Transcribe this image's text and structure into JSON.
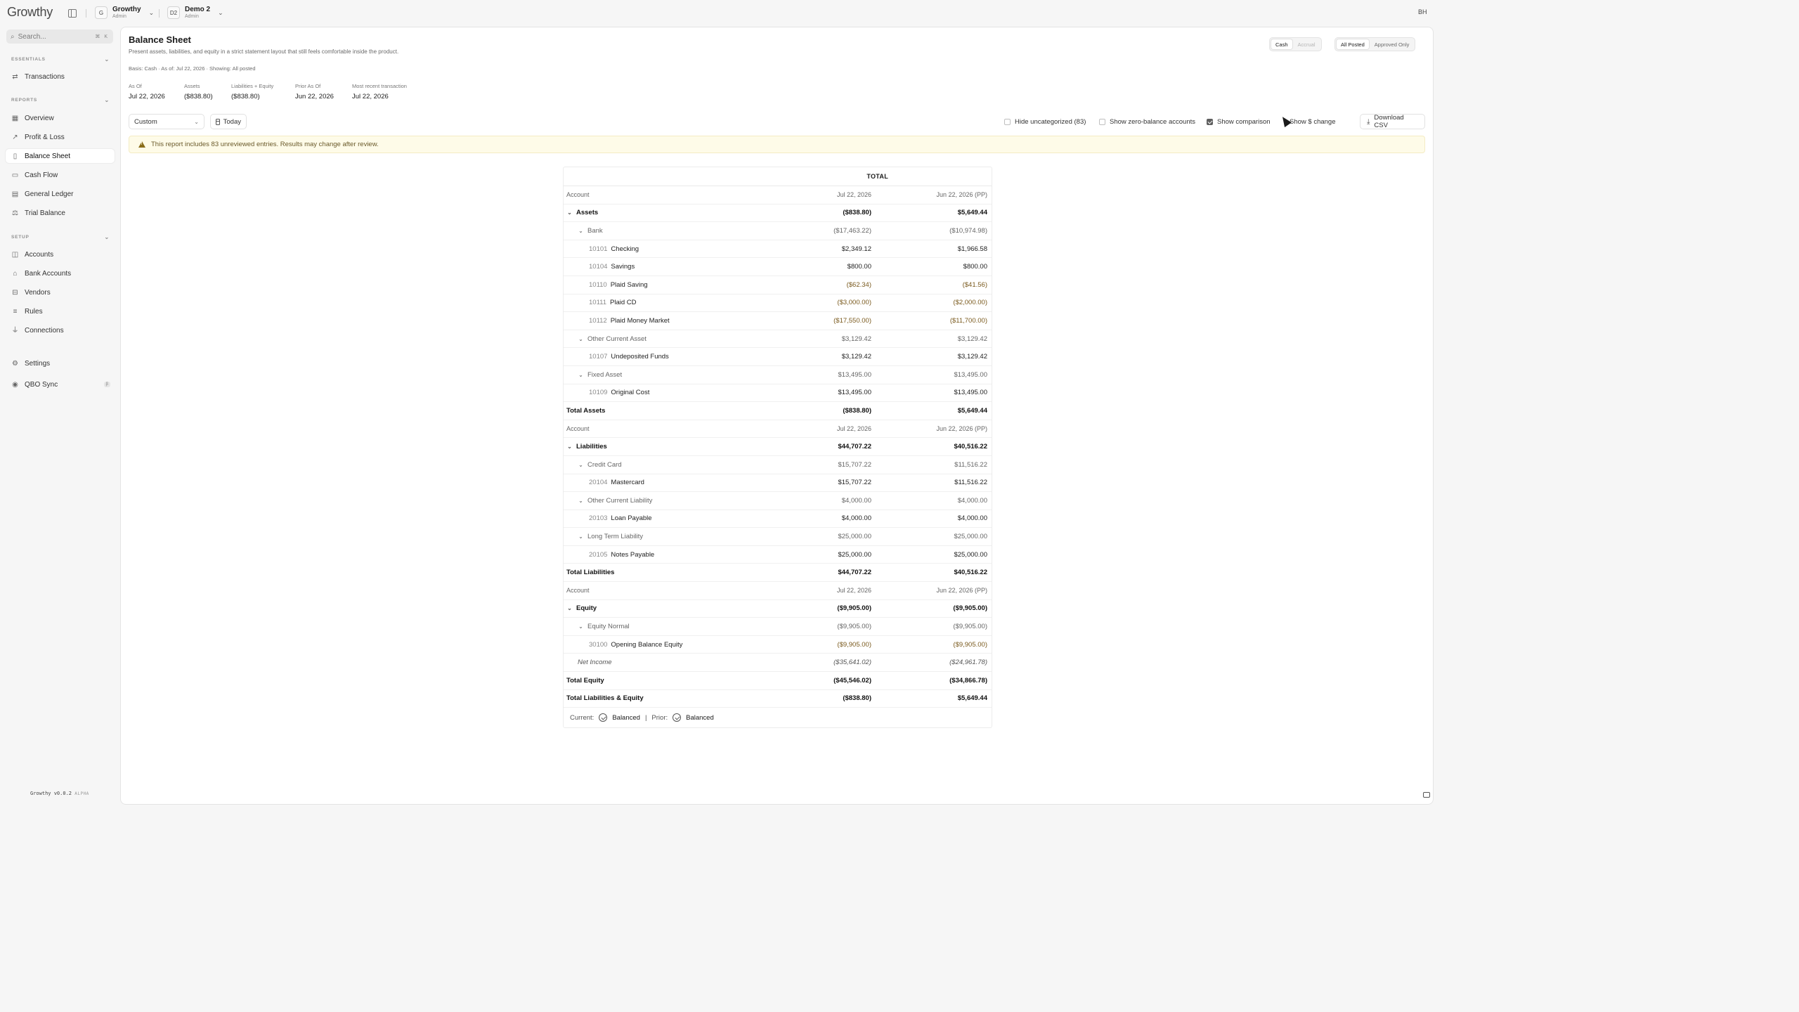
{
  "app": {
    "logo": "Growthy",
    "version": "Growthy v0.0.2",
    "version_tag": "ALPHA"
  },
  "header": {
    "org1": {
      "badge": "G",
      "name": "Growthy",
      "role": "Admin"
    },
    "org2": {
      "badge": "D2",
      "name": "Demo 2",
      "role": "Admin"
    },
    "user_initials": "BH"
  },
  "sidebar": {
    "search_placeholder": "Search...",
    "search_shortcut": "⌘ K",
    "sections": {
      "essentials": "ESSENTIALS",
      "reports": "REPORTS",
      "setup": "SETUP"
    },
    "items": {
      "transactions": "Transactions",
      "overview": "Overview",
      "profit_loss": "Profit & Loss",
      "balance_sheet": "Balance Sheet",
      "cash_flow": "Cash Flow",
      "general_ledger": "General Ledger",
      "trial_balance": "Trial Balance",
      "accounts": "Accounts",
      "bank_accounts": "Bank Accounts",
      "vendors": "Vendors",
      "rules": "Rules",
      "connections": "Connections",
      "settings": "Settings",
      "qbo_sync": "QBO Sync",
      "qbo_badge": "β"
    }
  },
  "page": {
    "title": "Balance Sheet",
    "subtitle": "Present assets, liabilities, and equity in a strict statement layout that still feels comfortable inside the product.",
    "basis_line": "Basis: Cash · As of: Jul 22, 2026 · Showing: All posted",
    "stats": [
      {
        "label": "As Of",
        "value": "Jul 22, 2026"
      },
      {
        "label": "Assets",
        "value": "($838.80)"
      },
      {
        "label": "Liabilities + Equity",
        "value": "($838.80)"
      },
      {
        "label": "Prior As Of",
        "value": "Jun 22, 2026"
      },
      {
        "label": "Most recent transaction",
        "value": "Jul 22, 2026"
      }
    ],
    "basis_toggle": {
      "cash": "Cash",
      "accrual": "Accrual",
      "selected": "Cash"
    },
    "status_toggle": {
      "all_posted": "All Posted",
      "approved_only": "Approved Only",
      "selected": "All Posted"
    }
  },
  "toolbar": {
    "period_select": "Custom",
    "today": "Today",
    "hide_uncategorized": "Hide uncategorized (83)",
    "show_zero_balance": "Show zero-balance accounts",
    "show_comparison": "Show comparison",
    "show_dollar_change": "Show $ change",
    "download_csv": "Download CSV",
    "checked": {
      "hide_uncategorized": false,
      "show_zero_balance": false,
      "show_comparison": true,
      "show_dollar_change": false
    }
  },
  "warning": {
    "text": "This report includes 83 unreviewed entries. Results may change after review."
  },
  "report": {
    "header": "TOTAL",
    "col_account": "Account",
    "col_current": "Jul 22, 2026",
    "col_prior": "Jun 22, 2026 (PP)",
    "rows": [
      {
        "kind": "colhdr"
      },
      {
        "kind": "section",
        "name": "Assets",
        "cur": "($838.80)",
        "prior": "$5,649.44"
      },
      {
        "kind": "group",
        "name": "Bank",
        "cur": "($17,463.22)",
        "prior": "($10,974.98)"
      },
      {
        "kind": "leaf",
        "code": "10101",
        "name": "Checking",
        "cur": "$2,349.12",
        "prior": "$1,966.58"
      },
      {
        "kind": "leaf",
        "code": "10104",
        "name": "Savings",
        "cur": "$800.00",
        "prior": "$800.00"
      },
      {
        "kind": "leaf",
        "code": "10110",
        "name": "Plaid Saving",
        "cur": "($62.34)",
        "prior": "($41.56)"
      },
      {
        "kind": "leaf",
        "code": "10111",
        "name": "Plaid CD",
        "cur": "($3,000.00)",
        "prior": "($2,000.00)"
      },
      {
        "kind": "leaf",
        "code": "10112",
        "name": "Plaid Money Market",
        "cur": "($17,550.00)",
        "prior": "($11,700.00)"
      },
      {
        "kind": "group",
        "name": "Other Current Asset",
        "cur": "$3,129.42",
        "prior": "$3,129.42"
      },
      {
        "kind": "leaf",
        "code": "10107",
        "name": "Undeposited Funds",
        "cur": "$3,129.42",
        "prior": "$3,129.42"
      },
      {
        "kind": "group",
        "name": "Fixed Asset",
        "cur": "$13,495.00",
        "prior": "$13,495.00"
      },
      {
        "kind": "leaf",
        "code": "10109",
        "name": "Original Cost",
        "cur": "$13,495.00",
        "prior": "$13,495.00"
      },
      {
        "kind": "total",
        "name": "Total Assets",
        "cur": "($838.80)",
        "prior": "$5,649.44"
      },
      {
        "kind": "colhdr"
      },
      {
        "kind": "section",
        "name": "Liabilities",
        "cur": "$44,707.22",
        "prior": "$40,516.22"
      },
      {
        "kind": "group",
        "name": "Credit Card",
        "cur": "$15,707.22",
        "prior": "$11,516.22"
      },
      {
        "kind": "leaf",
        "code": "20104",
        "name": "Mastercard",
        "cur": "$15,707.22",
        "prior": "$11,516.22"
      },
      {
        "kind": "group",
        "name": "Other Current Liability",
        "cur": "$4,000.00",
        "prior": "$4,000.00"
      },
      {
        "kind": "leaf",
        "code": "20103",
        "name": "Loan Payable",
        "cur": "$4,000.00",
        "prior": "$4,000.00"
      },
      {
        "kind": "group",
        "name": "Long Term Liability",
        "cur": "$25,000.00",
        "prior": "$25,000.00"
      },
      {
        "kind": "leaf",
        "code": "20105",
        "name": "Notes Payable",
        "cur": "$25,000.00",
        "prior": "$25,000.00"
      },
      {
        "kind": "total",
        "name": "Total Liabilities",
        "cur": "$44,707.22",
        "prior": "$40,516.22"
      },
      {
        "kind": "colhdr"
      },
      {
        "kind": "section",
        "name": "Equity",
        "cur": "($9,905.00)",
        "prior": "($9,905.00)"
      },
      {
        "kind": "group",
        "name": "Equity Normal",
        "cur": "($9,905.00)",
        "prior": "($9,905.00)"
      },
      {
        "kind": "leaf",
        "code": "30100",
        "name": "Opening Balance Equity",
        "cur": "($9,905.00)",
        "prior": "($9,905.00)"
      },
      {
        "kind": "ni",
        "name": "Net Income",
        "cur": "($35,641.02)",
        "prior": "($24,961.78)"
      },
      {
        "kind": "total",
        "name": "Total Equity",
        "cur": "($45,546.02)",
        "prior": "($34,866.78)"
      },
      {
        "kind": "total",
        "name": "Total Liabilities & Equity",
        "cur": "($838.80)",
        "prior": "$5,649.44"
      }
    ],
    "footer": {
      "current_label": "Current:",
      "current_status": "Balanced",
      "sep": "|",
      "prior_label": "Prior:",
      "prior_status": "Balanced"
    }
  },
  "colors": {
    "negative": "#7a5a1e",
    "warning_bg": "#fefbe8"
  }
}
